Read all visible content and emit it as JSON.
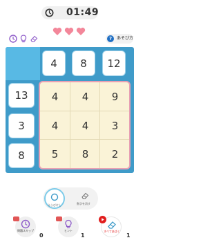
{
  "timer": {
    "time": "01:49"
  },
  "hearts": {
    "count": 3,
    "color": "#f3879a"
  },
  "rules_button": {
    "label": "あそび方"
  },
  "puzzle": {
    "column_clues": [
      "4",
      "8",
      "12"
    ],
    "row_clues": [
      "13",
      "3",
      "8"
    ],
    "grid": [
      [
        "4",
        "4",
        "9"
      ],
      [
        "4",
        "4",
        "3"
      ],
      [
        "5",
        "8",
        "2"
      ]
    ]
  },
  "mode_toggle": {
    "left_label": "えらびけし",
    "right_label": "数字を消す",
    "selected": "left"
  },
  "actions": {
    "skip": {
      "label": "問題スキップ",
      "count": "0"
    },
    "hint": {
      "label": "ヒント",
      "count": "1"
    },
    "full_hint": {
      "label": "すべてあばく",
      "count": "1"
    }
  },
  "colors": {
    "board": "#3f9bc9",
    "board_corner": "#58b9e4",
    "grid_bg": "#faf3d7",
    "grid_border": "#e8a0b3",
    "accent_blue": "#1f6fc4",
    "red": "#e15656"
  }
}
